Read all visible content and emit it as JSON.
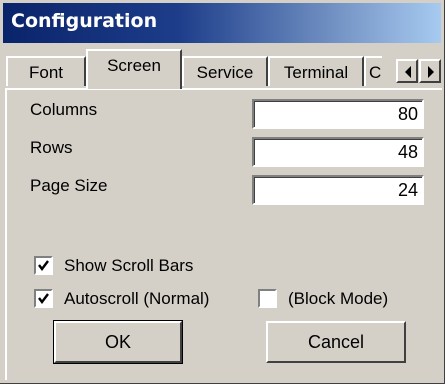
{
  "window": {
    "title": "Configuration"
  },
  "tabs": [
    {
      "label": "Font"
    },
    {
      "label": "Screen",
      "selected": true
    },
    {
      "label": "Service"
    },
    {
      "label": "Terminal"
    },
    {
      "label": "C"
    }
  ],
  "tab_scroll": {
    "left_icon": "arrow-left-icon",
    "right_icon": "arrow-right-icon"
  },
  "screen": {
    "columns_label": "Columns",
    "columns_value": "80",
    "rows_label": "Rows",
    "rows_value": "48",
    "page_size_label": "Page Size",
    "page_size_value": "24",
    "show_scroll_bars_label": "Show Scroll Bars",
    "show_scroll_bars_checked": true,
    "autoscroll_label": "Autoscroll (Normal)",
    "autoscroll_checked": true,
    "block_mode_label": "(Block Mode)",
    "block_mode_checked": false
  },
  "buttons": {
    "ok_label": "OK",
    "cancel_label": "Cancel"
  },
  "colors": {
    "titlebar_start": "#0a246a",
    "titlebar_end": "#a6caf0",
    "face": "#d4d0c8"
  }
}
